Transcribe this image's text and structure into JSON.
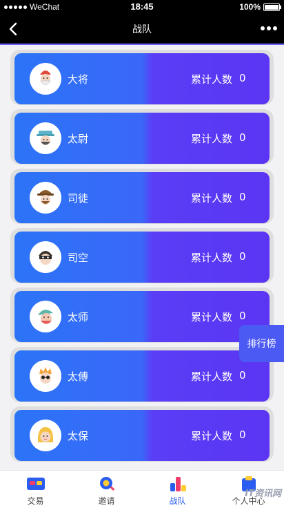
{
  "status_bar": {
    "carrier": "WeChat",
    "time": "18:45",
    "battery": "100%"
  },
  "nav": {
    "title": "战队"
  },
  "ranks": [
    {
      "name": "大将",
      "count_label": "累计人数",
      "count": "0",
      "icon": "general-avatar-icon"
    },
    {
      "name": "太尉",
      "count_label": "累计人数",
      "count": "0",
      "icon": "commandant-avatar-icon"
    },
    {
      "name": "司徒",
      "count_label": "累计人数",
      "count": "0",
      "icon": "minister-avatar-icon"
    },
    {
      "name": "司空",
      "count_label": "累计人数",
      "count": "0",
      "icon": "masked-avatar-icon"
    },
    {
      "name": "太师",
      "count_label": "累计人数",
      "count": "0",
      "icon": "tutor-avatar-icon"
    },
    {
      "name": "太傅",
      "count_label": "累计人数",
      "count": "0",
      "icon": "mentor-avatar-icon"
    },
    {
      "name": "太保",
      "count_label": "累计人数",
      "count": "0",
      "icon": "guardian-avatar-icon"
    }
  ],
  "float_button": {
    "label": "排行榜"
  },
  "tabs": [
    {
      "label": "交易",
      "icon": "trade-icon",
      "active": false
    },
    {
      "label": "邀请",
      "icon": "invite-icon",
      "active": false
    },
    {
      "label": "战队",
      "icon": "team-icon",
      "active": true
    },
    {
      "label": "个人中心",
      "icon": "profile-icon",
      "active": false
    }
  ],
  "watermark": "IT资讯网"
}
